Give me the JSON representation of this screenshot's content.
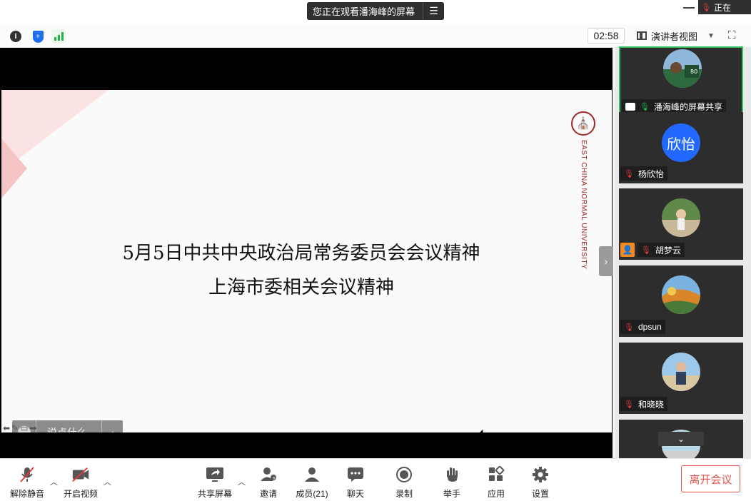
{
  "window": {
    "share_banner": "您正在观看潘海峰的屏幕",
    "corner_text": "正在"
  },
  "toolbar": {
    "timer": "02:58",
    "view_mode": "演讲者视图"
  },
  "slide": {
    "title_line1": "5月5日中共中央政治局常务委员会会议精神",
    "title_line2": "上海市委相关会议精神",
    "university": "EAST CHINA NORMAL UNIVERSITY",
    "chat_placeholder": "说点什么..."
  },
  "participants": [
    {
      "name": "潘海峰的屏幕共享",
      "status": "sharing",
      "avatar": "photo"
    },
    {
      "name": "杨欣怡",
      "status": "muted",
      "avatar_text": "欣怡"
    },
    {
      "name": "胡梦云",
      "status": "muted",
      "avatar": "photo"
    },
    {
      "name": "dpsun",
      "status": "muted",
      "avatar": "photo"
    },
    {
      "name": "和晓晓",
      "status": "muted",
      "avatar": "photo"
    }
  ],
  "bottom": {
    "unmute": "解除静音",
    "video": "开启视频",
    "share": "共享屏幕",
    "invite": "邀请",
    "members": "成员(21)",
    "chat": "聊天",
    "record": "录制",
    "raise_hand": "举手",
    "apps": "应用",
    "settings": "设置",
    "leave": "离开会议"
  },
  "colors": {
    "accent_blue": "#2068ff",
    "active_green": "#33c25d",
    "leave_red": "#e5534b",
    "ecnu_red": "#a32828"
  }
}
